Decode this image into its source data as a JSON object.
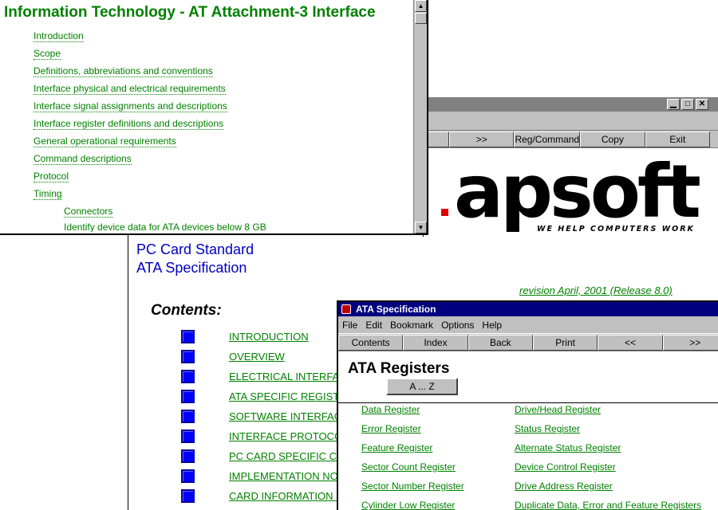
{
  "infotech": {
    "title": "Information Technology - AT Attachment-3 Interface",
    "items": [
      "Introduction",
      "Scope",
      "Definitions, abbreviations and conventions",
      "Interface physical and electrical requirements",
      "Interface signal assignments and descriptions",
      "Interface register definitions and descriptions",
      "General operational requirements",
      "Command descriptions",
      "Protocol",
      "Timing"
    ],
    "subitems": [
      "Connectors",
      "Identify device data for ATA devices below 8 GB"
    ]
  },
  "apsoft": {
    "buttons": [
      ">>",
      "Reg/Command",
      "Copy",
      "Exit"
    ],
    "logo_text": "apsoft",
    "tagline": "WE HELP COMPUTERS WORK",
    "accent": "#e00000"
  },
  "pccard": {
    "title_line1": "PC Card Standard",
    "title_line2": "ATA Specification",
    "revision": "revision April, 2001 (Release 8.0)",
    "contents_heading": "Contents:",
    "items": [
      "INTRODUCTION",
      "OVERVIEW",
      "ELECTRICAL INTERFA",
      "ATA SPECIFIC REGIST",
      "SOFTWARE INTERFAC",
      "INTERFACE PROTOCO",
      "PC CARD SPECIFIC C",
      "IMPLEMENTATION NO",
      "CARD INFORMATION S"
    ]
  },
  "ata": {
    "window_title": "ATA Specification",
    "menu": [
      "File",
      "Edit",
      "Bookmark",
      "Options",
      "Help"
    ],
    "buttons": [
      "Contents",
      "Index",
      "Back",
      "Print",
      "<<",
      ">>"
    ],
    "heading": "ATA Registers",
    "az_button": "A ... Z",
    "registers_left": [
      "Data Register",
      "Error Register",
      "Feature Register",
      "Sector Count Register",
      "Sector Number Register",
      "Cylinder Low Register"
    ],
    "registers_right": [
      "Drive/Head Register",
      "Status Register",
      "Alternate Status Register",
      "Device Control Register",
      "Drive Address Register",
      "Duplicate Data, Error and Feature Registers"
    ]
  },
  "colors": {
    "link_green": "#008000",
    "title_blue": "#0000c0",
    "titlebar": "#000080"
  }
}
